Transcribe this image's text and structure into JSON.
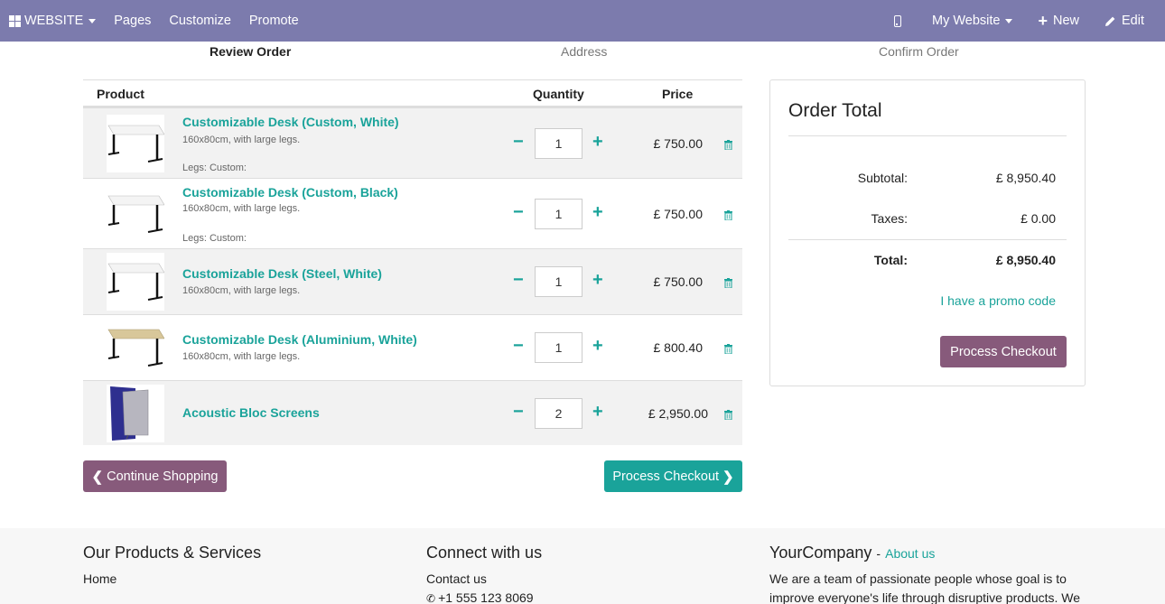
{
  "topbar": {
    "brand": "WEBSITE",
    "menu": [
      "Pages",
      "Customize",
      "Promote"
    ],
    "site_label": "My Website",
    "new_label": "New",
    "edit_label": "Edit"
  },
  "steps": [
    "Review Order",
    "Address",
    "Confirm Order"
  ],
  "cart": {
    "headers": {
      "product": "Product",
      "quantity": "Quantity",
      "price": "Price"
    },
    "items": [
      {
        "name": "Customizable Desk (Custom, White)",
        "desc": "160x80cm, with large legs.",
        "variant": "Legs: Custom:",
        "qty": "1",
        "price": "£ 750.00"
      },
      {
        "name": "Customizable Desk (Custom, Black)",
        "desc": "160x80cm, with large legs.",
        "variant": "Legs: Custom:",
        "qty": "1",
        "price": "£ 750.00"
      },
      {
        "name": "Customizable Desk (Steel, White)",
        "desc": "160x80cm, with large legs.",
        "variant": "",
        "qty": "1",
        "price": "£ 750.00"
      },
      {
        "name": "Customizable Desk (Aluminium, White)",
        "desc": "160x80cm, with large legs.",
        "variant": "",
        "qty": "1",
        "price": "£ 800.40"
      },
      {
        "name": "Acoustic Bloc Screens",
        "desc": "",
        "variant": "",
        "qty": "2",
        "price": "£ 2,950.00"
      }
    ],
    "continue_label": "Continue Shopping",
    "checkout_label": "Process Checkout"
  },
  "order_total": {
    "title": "Order Total",
    "subtotal_label": "Subtotal:",
    "subtotal": "£ 8,950.40",
    "taxes_label": "Taxes:",
    "taxes": "£ 0.00",
    "total_label": "Total:",
    "total": "£ 8,950.40",
    "promo_label": "I have a promo code",
    "checkout_label": "Process Checkout"
  },
  "footer": {
    "products_title": "Our Products & Services",
    "home_link": "Home",
    "connect_title": "Connect with us",
    "contact_link": "Contact us",
    "phone": "+1 555 123 8069",
    "company": "YourCompany",
    "company_sep": "-",
    "about_link": "About us",
    "about_text": "We are a team of passionate people whose goal is to improve everyone's life through disruptive products. We"
  },
  "colors": {
    "navbar": "#7c7bad",
    "accent": "#1aa39a",
    "primary_button": "#875a7b"
  }
}
